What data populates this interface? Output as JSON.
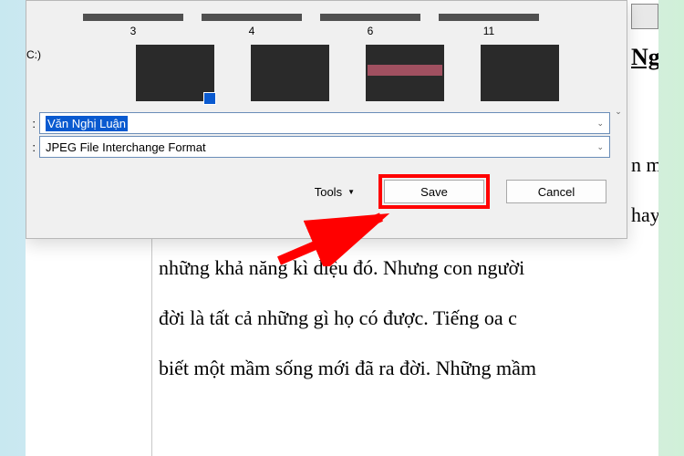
{
  "dialog": {
    "drive_label": "C:)",
    "thumb_labels": [
      "3",
      "4",
      "6",
      "11"
    ],
    "filename_field": {
      "label": ":",
      "value": "Văn Nghị Luận"
    },
    "filetype_field": {
      "label": ":",
      "value": "JPEG File Interchange Format"
    },
    "tools_label": "Tools",
    "save_label": "Save",
    "cancel_label": "Cancel"
  },
  "document": {
    "side_heading": "Ngh",
    "side_line1": "n mỗi",
    "side_line2": "hay nh",
    "line1": "những khả năng kì diệu đó. Nhưng con người",
    "line2": "đời là tất cả những gì họ có được. Tiếng oa c",
    "line3": "biết một mầm sống mới đã ra đời. Những mầm"
  }
}
